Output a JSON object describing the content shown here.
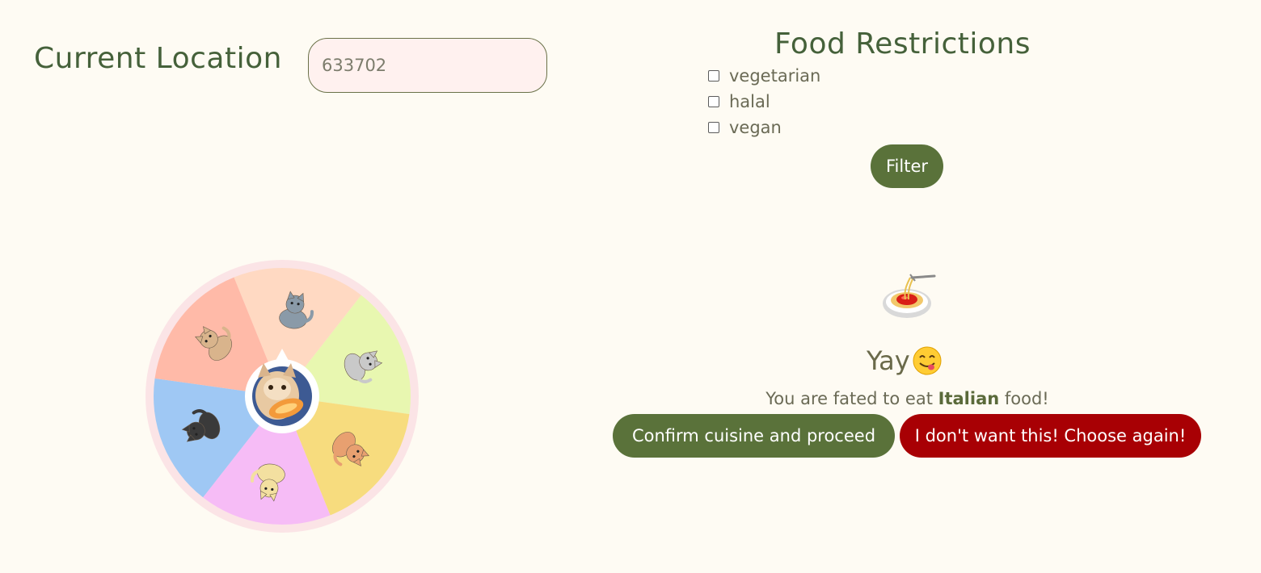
{
  "location": {
    "title": "Current Location",
    "value": "633702"
  },
  "restrictions": {
    "title": "Food Restrictions",
    "options": [
      {
        "label": "vegetarian",
        "checked": false
      },
      {
        "label": "halal",
        "checked": false
      },
      {
        "label": "vegan",
        "checked": false
      }
    ],
    "filter_label": "Filter"
  },
  "wheel": {
    "center_icon": "cat-eating-photo",
    "segments": [
      {
        "color": "#ffd9c2",
        "icon": "cat-playing-icon"
      },
      {
        "color": "#e8f7b0",
        "icon": "cat-sleeping-icon"
      },
      {
        "color": "#f7dc7e",
        "icon": "cat-reaching-icon"
      },
      {
        "color": "#f6bcf6",
        "icon": "cat-lying-icon"
      },
      {
        "color": "#9fc8f4",
        "icon": "cat-sitting-icon"
      },
      {
        "color": "#ffbaa8",
        "icon": "cat-stretching-icon"
      }
    ]
  },
  "result": {
    "food_icon": "spaghetti-icon",
    "yay_text": "Yay",
    "yay_icon": "yum-face-icon",
    "fate_prefix": "You are fated to eat",
    "cuisine": "Italian",
    "fate_suffix": "food!",
    "confirm_label": "Confirm cuisine and proceed",
    "reject_label": "I don't want this! Choose again!"
  }
}
